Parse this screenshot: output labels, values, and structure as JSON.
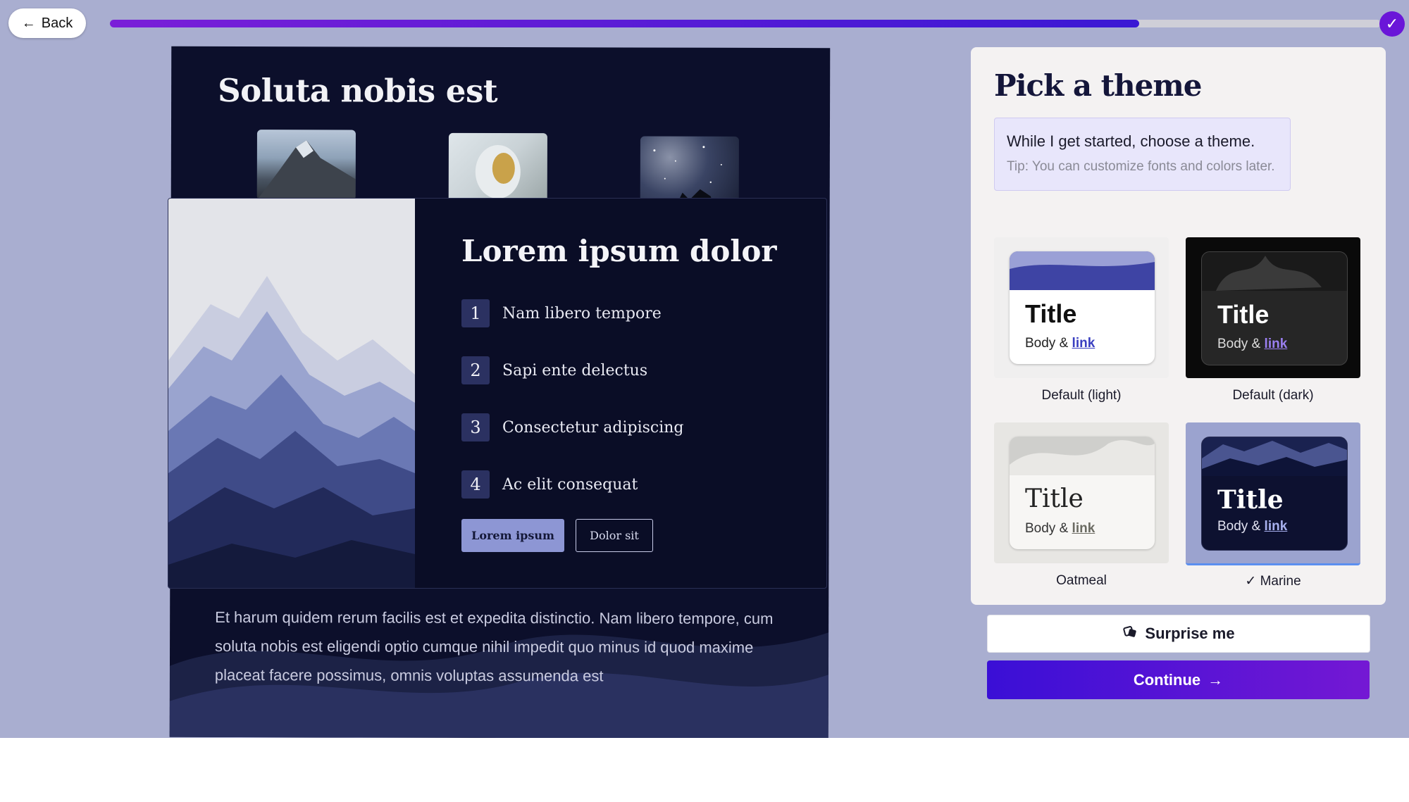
{
  "topbar": {
    "back_label": "Back",
    "progress_fraction": 0.81
  },
  "preview": {
    "title": "Soluta nobis est",
    "slide": {
      "heading": "Lorem ipsum dolor",
      "items": [
        {
          "num": "1",
          "text": "Nam libero tempore"
        },
        {
          "num": "2",
          "text": "Sapi ente delectus"
        },
        {
          "num": "3",
          "text": "Consectetur adipiscing"
        },
        {
          "num": "4",
          "text": "Ac elit consequat"
        }
      ],
      "primary_button": "Lorem ipsum",
      "secondary_button": "Dolor sit"
    },
    "body_text": "Et harum quidem rerum facilis est et expedita distinctio. Nam libero tempore, cum soluta nobis est eligendi optio cumque nihil impedit quo minus id quod maxime placeat facere possimus, omnis voluptas assumenda est"
  },
  "panel": {
    "title": "Pick a theme",
    "message": "While I get started, choose a theme.",
    "tip": "Tip: You can customize fonts and colors later.",
    "themes": [
      {
        "name": "Default (light)",
        "card_title": "Title",
        "body": "Body & ",
        "link": "link",
        "selected": false
      },
      {
        "name": "Default (dark)",
        "card_title": "Title",
        "body": "Body & ",
        "link": "link",
        "selected": false
      },
      {
        "name": "Oatmeal",
        "card_title": "Title",
        "body": "Body & ",
        "link": "link",
        "selected": false
      },
      {
        "name": "Marine",
        "card_title": "Title",
        "body": "Body & ",
        "link": "link",
        "selected": true
      }
    ],
    "selected_check": "✓",
    "surprise_label": "Surprise me",
    "continue_label": "Continue"
  },
  "colors": {
    "background": "#a9aed0",
    "accent": "#5a16d6",
    "preview_bg": "#0c0f2b"
  }
}
